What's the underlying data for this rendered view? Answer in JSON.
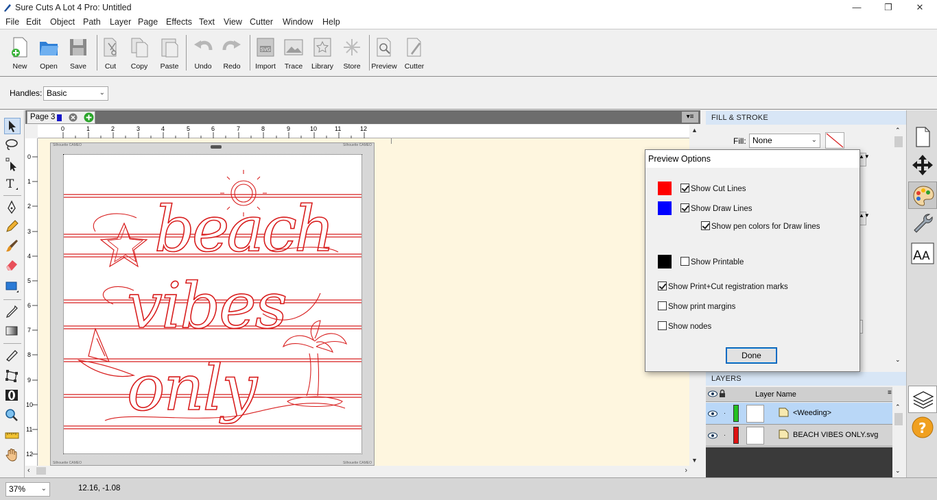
{
  "window": {
    "title": "Sure Cuts A Lot 4 Pro: Untitled",
    "controls": [
      "—",
      "❐",
      "✕"
    ]
  },
  "menu": [
    "File",
    "Edit",
    "Object",
    "Path",
    "Layer",
    "Page",
    "Effects",
    "Text",
    "View",
    "Cutter",
    "Window",
    "Help"
  ],
  "toolbar": {
    "new": "New",
    "open": "Open",
    "save": "Save",
    "cut": "Cut",
    "copy": "Copy",
    "paste": "Paste",
    "undo": "Undo",
    "redo": "Redo",
    "import": "Import",
    "trace": "Trace",
    "library": "Library",
    "store": "Store",
    "preview": "Preview",
    "cutter": "Cutter"
  },
  "options": {
    "handles_label": "Handles:",
    "handles_value": "Basic"
  },
  "doc": {
    "page_tab": "Page 3"
  },
  "ruler": {
    "h": [
      "0",
      "1",
      "2",
      "3",
      "4",
      "5",
      "6",
      "7",
      "8",
      "9",
      "10",
      "11",
      "12"
    ],
    "v": [
      "0",
      "1",
      "2",
      "3",
      "4",
      "5",
      "6",
      "7",
      "8",
      "9",
      "10",
      "11",
      "12"
    ]
  },
  "mat": {
    "label_tl": "Silhouette CAMEO",
    "label_tr": "Silhouette CAMEO",
    "label_bl": "Silhouette CAMEO",
    "label_br": "Silhouette CAMEO"
  },
  "design": {
    "words": [
      "beach",
      "vibes",
      "only"
    ]
  },
  "status": {
    "zoom": "37%",
    "coords": "12.16, -1.08"
  },
  "fill_stroke": {
    "header": "FILL & STROKE",
    "fill_label": "Fill:",
    "fill_value": "None"
  },
  "layers": {
    "header": "LAYERS",
    "column": "Layer Name",
    "rows": [
      {
        "name": "<Weeding>",
        "color": "#22c022"
      },
      {
        "name": "BEACH VIBES ONLY.svg",
        "color": "#dd1111"
      }
    ]
  },
  "preview_dialog": {
    "title": "Preview Options",
    "show_cut_lines": "Show Cut Lines",
    "show_draw_lines": "Show Draw Lines",
    "show_pen_colors": "Show pen colors for Draw lines",
    "show_printable": "Show Printable",
    "show_reg_marks": "Show Print+Cut registration marks",
    "show_print_margins": "Show print margins",
    "show_nodes": "Show nodes",
    "done": "Done",
    "cut_color": "#ff0000",
    "draw_color": "#0000ff",
    "print_color": "#000000",
    "checked": {
      "show_cut_lines": true,
      "show_draw_lines": true,
      "show_pen_colors": true,
      "show_printable": false,
      "show_reg_marks": true,
      "show_print_margins": false,
      "show_nodes": false
    }
  },
  "colors": {
    "design_red": "#d81e1e",
    "canvas_bg": "#fef6df",
    "panel_header": "#d8e6f6",
    "layer_selected": "#b9d7f7"
  }
}
